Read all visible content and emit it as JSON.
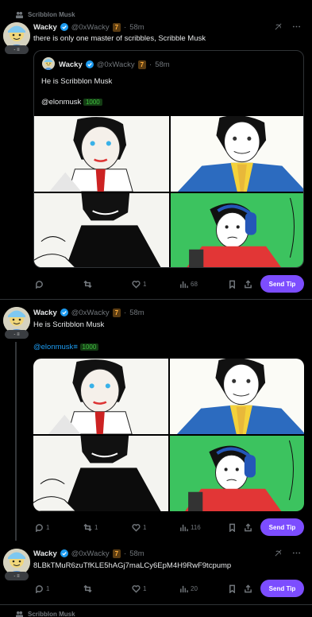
{
  "context_label": "Scribblon Musk",
  "tweets": [
    {
      "name": "Wacky",
      "handle": "@0xWacky",
      "level": "7",
      "time": "58m",
      "badge": "- ≡",
      "text": "there is only one master of scribbles, Scribble Musk",
      "quote": {
        "name": "Wacky",
        "handle": "@0xWacky",
        "level": "7",
        "time": "58m",
        "text": "He is Scribblon Musk",
        "mention": "@elonmusk",
        "amount": "1000"
      },
      "actions": {
        "replies": "",
        "reposts": "",
        "likes": "1",
        "views": "68"
      },
      "tip_label": "Send Tip"
    },
    {
      "name": "Wacky",
      "handle": "@0xWacky",
      "level": "7",
      "time": "58m",
      "badge": "- ≡",
      "text": "He is Scribblon Musk",
      "mention": "@elonmusk",
      "mention_icon": "≡",
      "amount": "1000",
      "actions": {
        "replies": "1",
        "reposts": "1",
        "likes": "1",
        "views": "116"
      },
      "tip_label": "Send Tip"
    },
    {
      "name": "Wacky",
      "handle": "@0xWacky",
      "level": "7",
      "time": "58m",
      "badge": "- ≡",
      "text": "8LBkTMuR6zuTfKLE5hAGj7maLCy6EpM4H9RwF9tcpump",
      "actions": {
        "replies": "1",
        "reposts": "",
        "likes": "1",
        "views": "20"
      },
      "tip_label": "Send Tip"
    }
  ],
  "footer_context": "Scribblon Musk",
  "colors": {
    "accent": "#1d9bf0",
    "tip": "#7c4dff",
    "level": "#ffad3a",
    "amount": "#3fbf3f"
  }
}
